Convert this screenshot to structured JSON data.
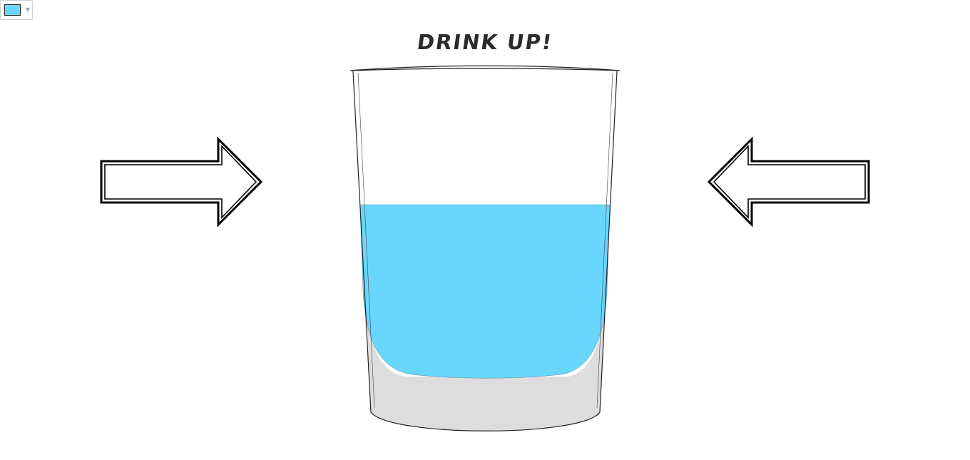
{
  "title": "DRINK UP!",
  "color_picker": {
    "selected_color": "#69d7fd",
    "caret": "▼"
  },
  "glass": {
    "water_color": "#69d7fd",
    "glass_shade_color": "#dddddd",
    "outline_color": "#222222",
    "water_level_fraction": 0.64
  },
  "arrows": {
    "left_arrow_direction": "right",
    "right_arrow_direction": "left"
  }
}
